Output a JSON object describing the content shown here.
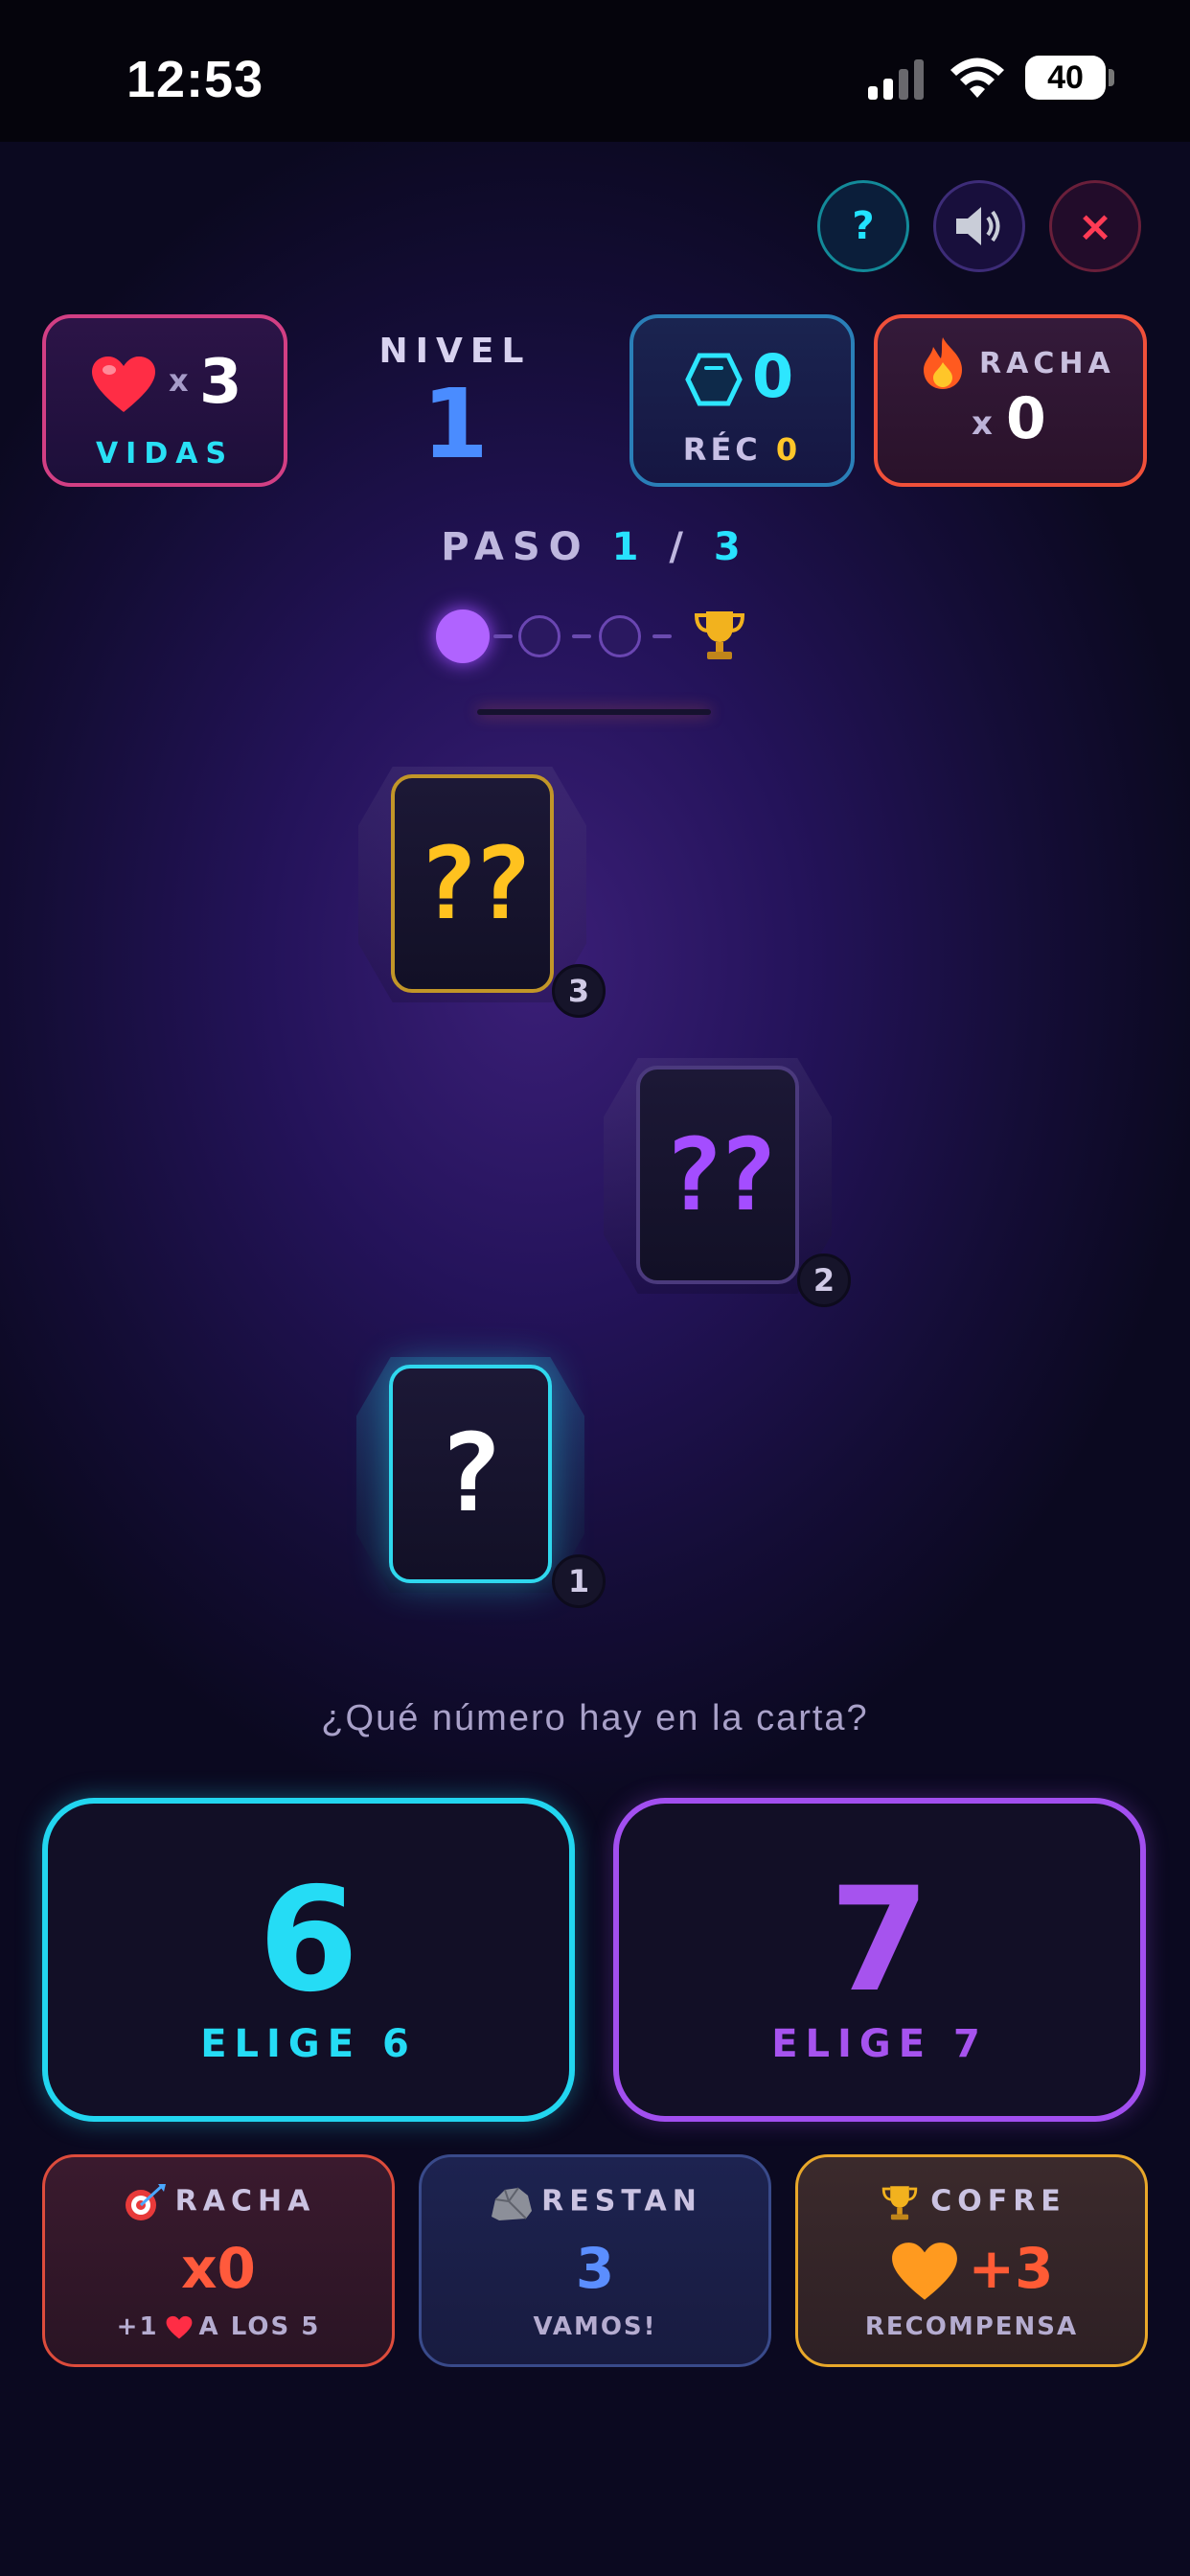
{
  "status_bar": {
    "time": "12:53",
    "battery": "40"
  },
  "top_buttons": {
    "help": "?",
    "close": "×"
  },
  "lives": {
    "multiplier": "x",
    "count": "3",
    "label": "VIDAS"
  },
  "level": {
    "label": "NIVEL",
    "number": "1"
  },
  "record": {
    "value": "0",
    "label": "RÉC",
    "label_value": "0"
  },
  "streak_top": {
    "label": "RACHA",
    "multiplier": "x",
    "value": "0"
  },
  "step": {
    "label": "PASO",
    "current": "1",
    "separator": "/",
    "total": "3"
  },
  "progress": {
    "current_step": 1,
    "total_steps": 3
  },
  "cards": [
    {
      "face": "??",
      "badge": "3"
    },
    {
      "face": "??",
      "badge": "2"
    },
    {
      "face": "?",
      "badge": "1"
    }
  ],
  "question": "¿Qué número hay en la carta?",
  "answers": [
    {
      "number": "6",
      "label": "ELIGE 6",
      "color": "#25dcf5"
    },
    {
      "number": "7",
      "label": "ELIGE 7",
      "color": "#a653ee"
    }
  ],
  "bottom": {
    "racha": {
      "title": "RACHA",
      "value": "x0",
      "foot_pre": "+1",
      "foot_post": "A LOS 5"
    },
    "restan": {
      "title": "RESTAN",
      "value": "3",
      "foot": "VAMOS!"
    },
    "cofre": {
      "title": "COFRE",
      "value": "+3",
      "foot": "RECOMPENSA"
    }
  },
  "colors": {
    "cyan": "#22d6f0",
    "purple": "#a24ff0",
    "gold": "#ffc21f",
    "orange": "#ff5a3c"
  }
}
